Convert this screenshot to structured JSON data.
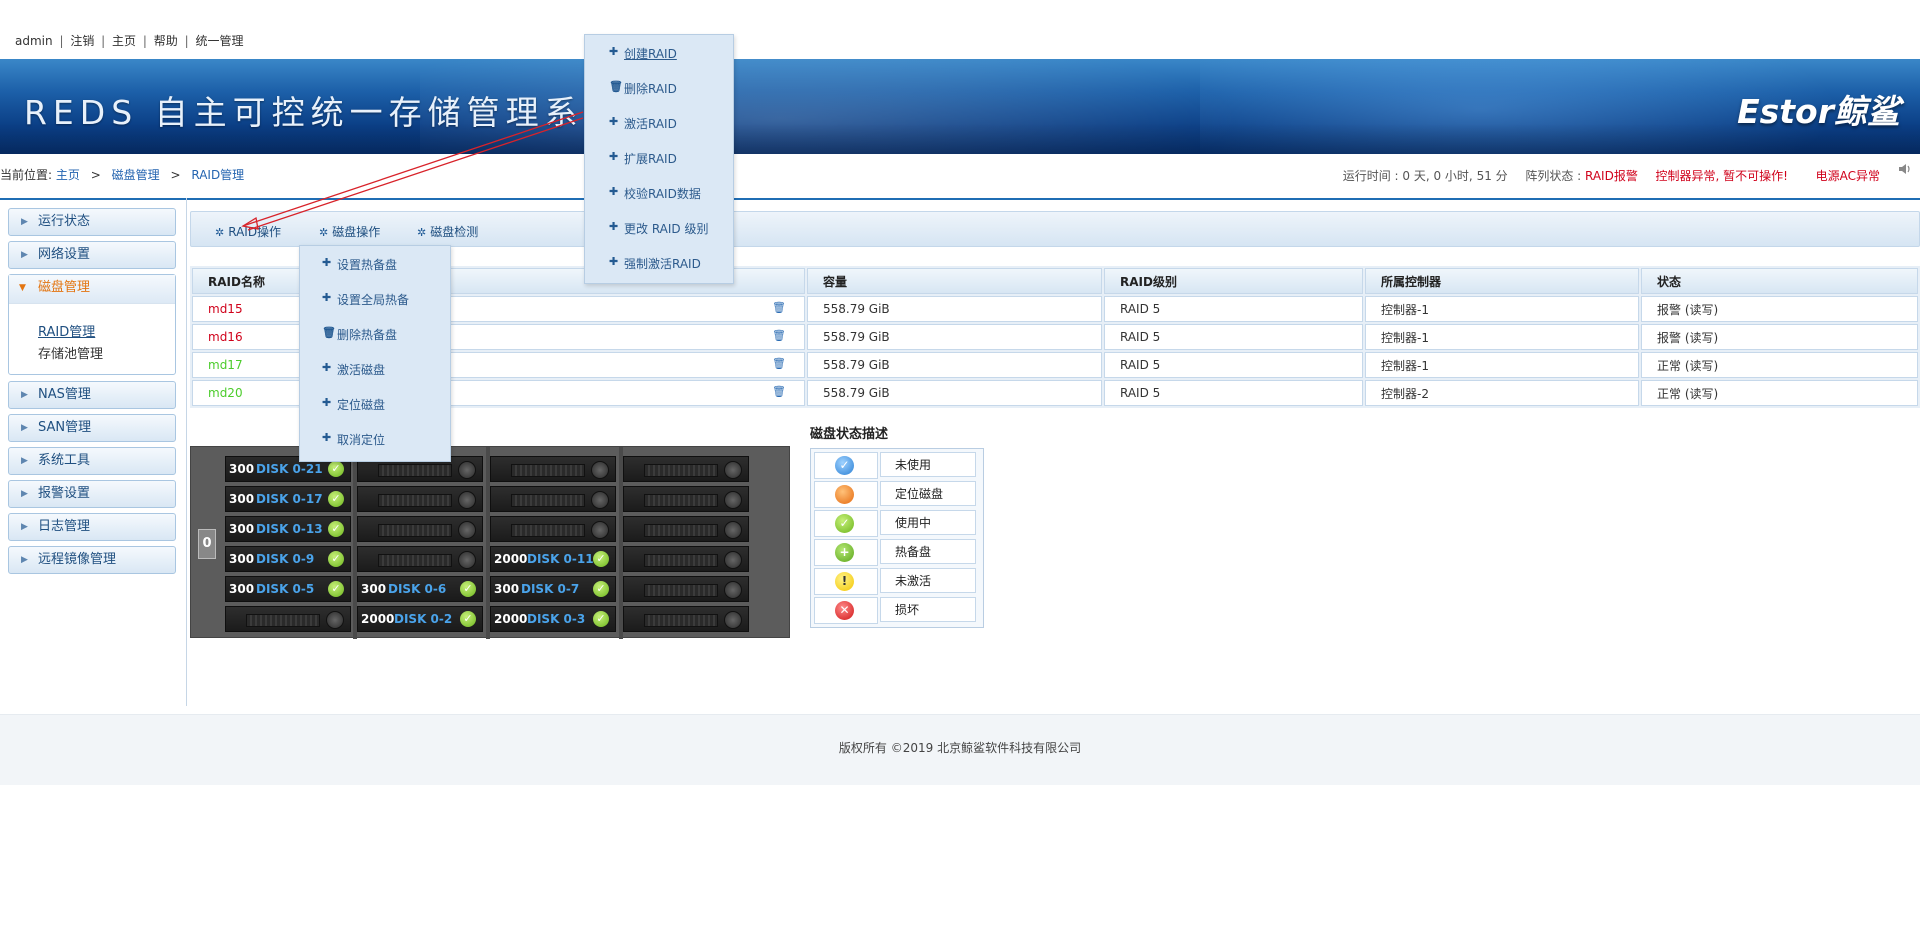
{
  "topbar": {
    "user": "admin",
    "logout": "注销",
    "home": "主页",
    "help": "帮助",
    "unified": "统一管理",
    "sep": "|"
  },
  "banner": {
    "title": "REDS 自主可控统一存储管理系统",
    "logo": "Estor鲸鲨"
  },
  "breadcrumb": {
    "prefix": "当前位置:",
    "home": "主页",
    "gt": ">",
    "level1": "磁盘管理",
    "level2": "RAID管理"
  },
  "status": {
    "uptime_label": "运行时间 : 0 天, 0 小时, 51 分",
    "array_label": "阵列状态 :",
    "raid_alarm": "RAID报警",
    "controller_msg": "控制器异常, 暂不可操作!",
    "power_msg": "电源AC异常"
  },
  "sidebar": {
    "items": [
      {
        "label": "运行状态"
      },
      {
        "label": "网络设置"
      },
      {
        "label": "磁盘管理"
      },
      {
        "label": "NAS管理"
      },
      {
        "label": "SAN管理"
      },
      {
        "label": "系统工具"
      },
      {
        "label": "报警设置"
      },
      {
        "label": "日志管理"
      },
      {
        "label": "远程镜像管理"
      }
    ],
    "sub": [
      {
        "label": "RAID管理"
      },
      {
        "label": "存储池管理"
      }
    ]
  },
  "tabs": [
    {
      "label": "RAID操作"
    },
    {
      "label": "磁盘操作"
    },
    {
      "label": "磁盘检测"
    }
  ],
  "raid_menu": [
    {
      "label": "创建RAID",
      "icon": "+"
    },
    {
      "label": "删除RAID",
      "icon": "trash"
    },
    {
      "label": "激活RAID",
      "icon": "+"
    },
    {
      "label": "扩展RAID",
      "icon": "+"
    },
    {
      "label": "校验RAID数据",
      "icon": "+"
    },
    {
      "label": "更改 RAID 级别",
      "icon": "+"
    },
    {
      "label": "强制激活RAID",
      "icon": "+"
    }
  ],
  "disk_menu": [
    {
      "label": "设置热备盘",
      "icon": "+"
    },
    {
      "label": "设置全局热备",
      "icon": "+"
    },
    {
      "label": "删除热备盘",
      "icon": "trash"
    },
    {
      "label": "激活磁盘",
      "icon": "+"
    },
    {
      "label": "定位磁盘",
      "icon": "+"
    },
    {
      "label": "取消定位",
      "icon": "+"
    }
  ],
  "table": {
    "headers": [
      "RAID名称",
      "容量",
      "RAID级别",
      "所属控制器",
      "状态"
    ],
    "rows": [
      {
        "name": "md15",
        "capacity": "558.79 GiB",
        "level": "RAID 5",
        "controller": "控制器-1",
        "state": "报警 (读写)",
        "color": "#d0021b"
      },
      {
        "name": "md16",
        "capacity": "558.79 GiB",
        "level": "RAID 5",
        "controller": "控制器-1",
        "state": "报警 (读写)",
        "color": "#d0021b"
      },
      {
        "name": "md17",
        "capacity": "558.79 GiB",
        "level": "RAID 5",
        "controller": "控制器-1",
        "state": "正常 (读写)",
        "color": "#4ccc2c"
      },
      {
        "name": "md20",
        "capacity": "558.79 GiB",
        "level": "RAID 5",
        "controller": "控制器-2",
        "state": "正常 (读写)",
        "color": "#4ccc2c"
      }
    ]
  },
  "chassis": {
    "ear": "0",
    "disks": [
      {
        "cap": "300",
        "label": "DISK 0-21"
      },
      {
        "cap": "300",
        "label": "DISK 0-17"
      },
      {
        "cap": "300",
        "label": "DISK 0-13"
      },
      {
        "cap": "300",
        "label": "DISK 0-9"
      },
      {
        "cap": "2000",
        "label": "DISK 0-11"
      },
      {
        "cap": "300",
        "label": "DISK 0-5"
      },
      {
        "cap": "300",
        "label": "DISK 0-6"
      },
      {
        "cap": "300",
        "label": "DISK 0-7"
      },
      {
        "cap": "2000",
        "label": "DISK 0-2"
      },
      {
        "cap": "2000",
        "label": "DISK 0-3"
      }
    ]
  },
  "legend": {
    "title": "磁盘状态描述",
    "items": [
      {
        "label": "未使用",
        "icon": "check-blue-icon"
      },
      {
        "label": "定位磁盘",
        "icon": "orange-dot-icon"
      },
      {
        "label": "使用中",
        "icon": "check-green-icon"
      },
      {
        "label": "热备盘",
        "icon": "plus-green-icon"
      },
      {
        "label": "未激活",
        "icon": "exclamation-icon"
      },
      {
        "label": "损坏",
        "icon": "x-red-icon"
      }
    ]
  },
  "footer": {
    "text": "版权所有 ©2019 北京鲸鲨软件科技有限公司"
  },
  "colors": {
    "accent": "#1f6db4",
    "alarm": "#d0021b",
    "ok": "#4ccc2c",
    "active_menu": "#e37511"
  }
}
